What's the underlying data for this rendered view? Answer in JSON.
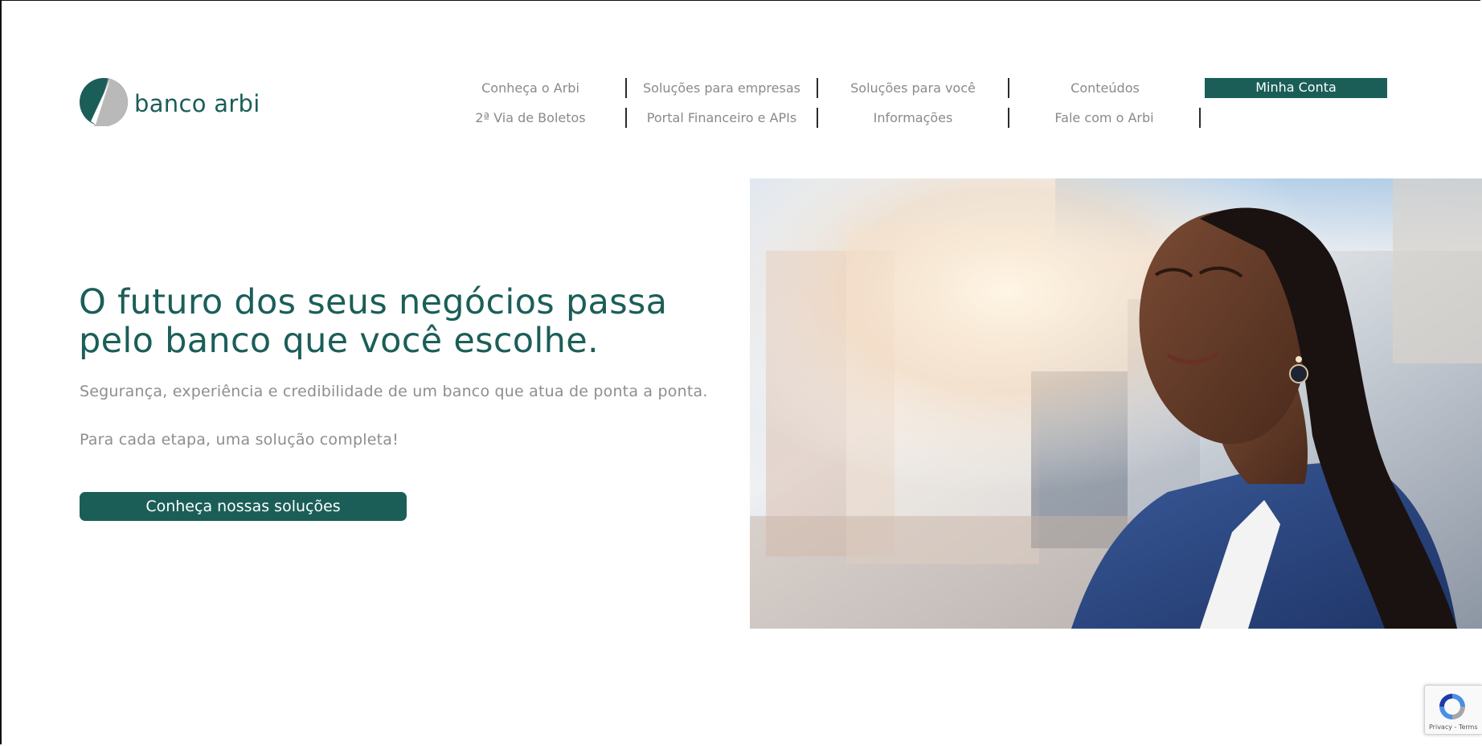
{
  "brand": {
    "name": "banco arbi",
    "color": "#1b5e58"
  },
  "nav": {
    "row1": [
      {
        "label": "Conheça o Arbi"
      },
      {
        "label": "Soluções para empresas"
      },
      {
        "label": "Soluções para você"
      },
      {
        "label": "Conteúdos"
      }
    ],
    "row2": [
      {
        "label": "2ª Via de Boletos"
      },
      {
        "label": "Portal Financeiro e APIs"
      },
      {
        "label": "Informações"
      },
      {
        "label": "Fale com o Arbi"
      }
    ],
    "account_button": "Minha Conta"
  },
  "hero": {
    "headline": "O futuro dos seus negócios passa pelo banco que você escolhe.",
    "subtitle": "Segurança, experiência e credibilidade de um banco que atua de ponta a ponta.",
    "tagline": "Para cada etapa, uma solução completa!",
    "cta_label": "Conheça nossas soluções",
    "image": "smiling-businesswoman-photo"
  },
  "recaptcha": {
    "links": "Privacy - Terms",
    "icon": "recaptcha-icon"
  }
}
